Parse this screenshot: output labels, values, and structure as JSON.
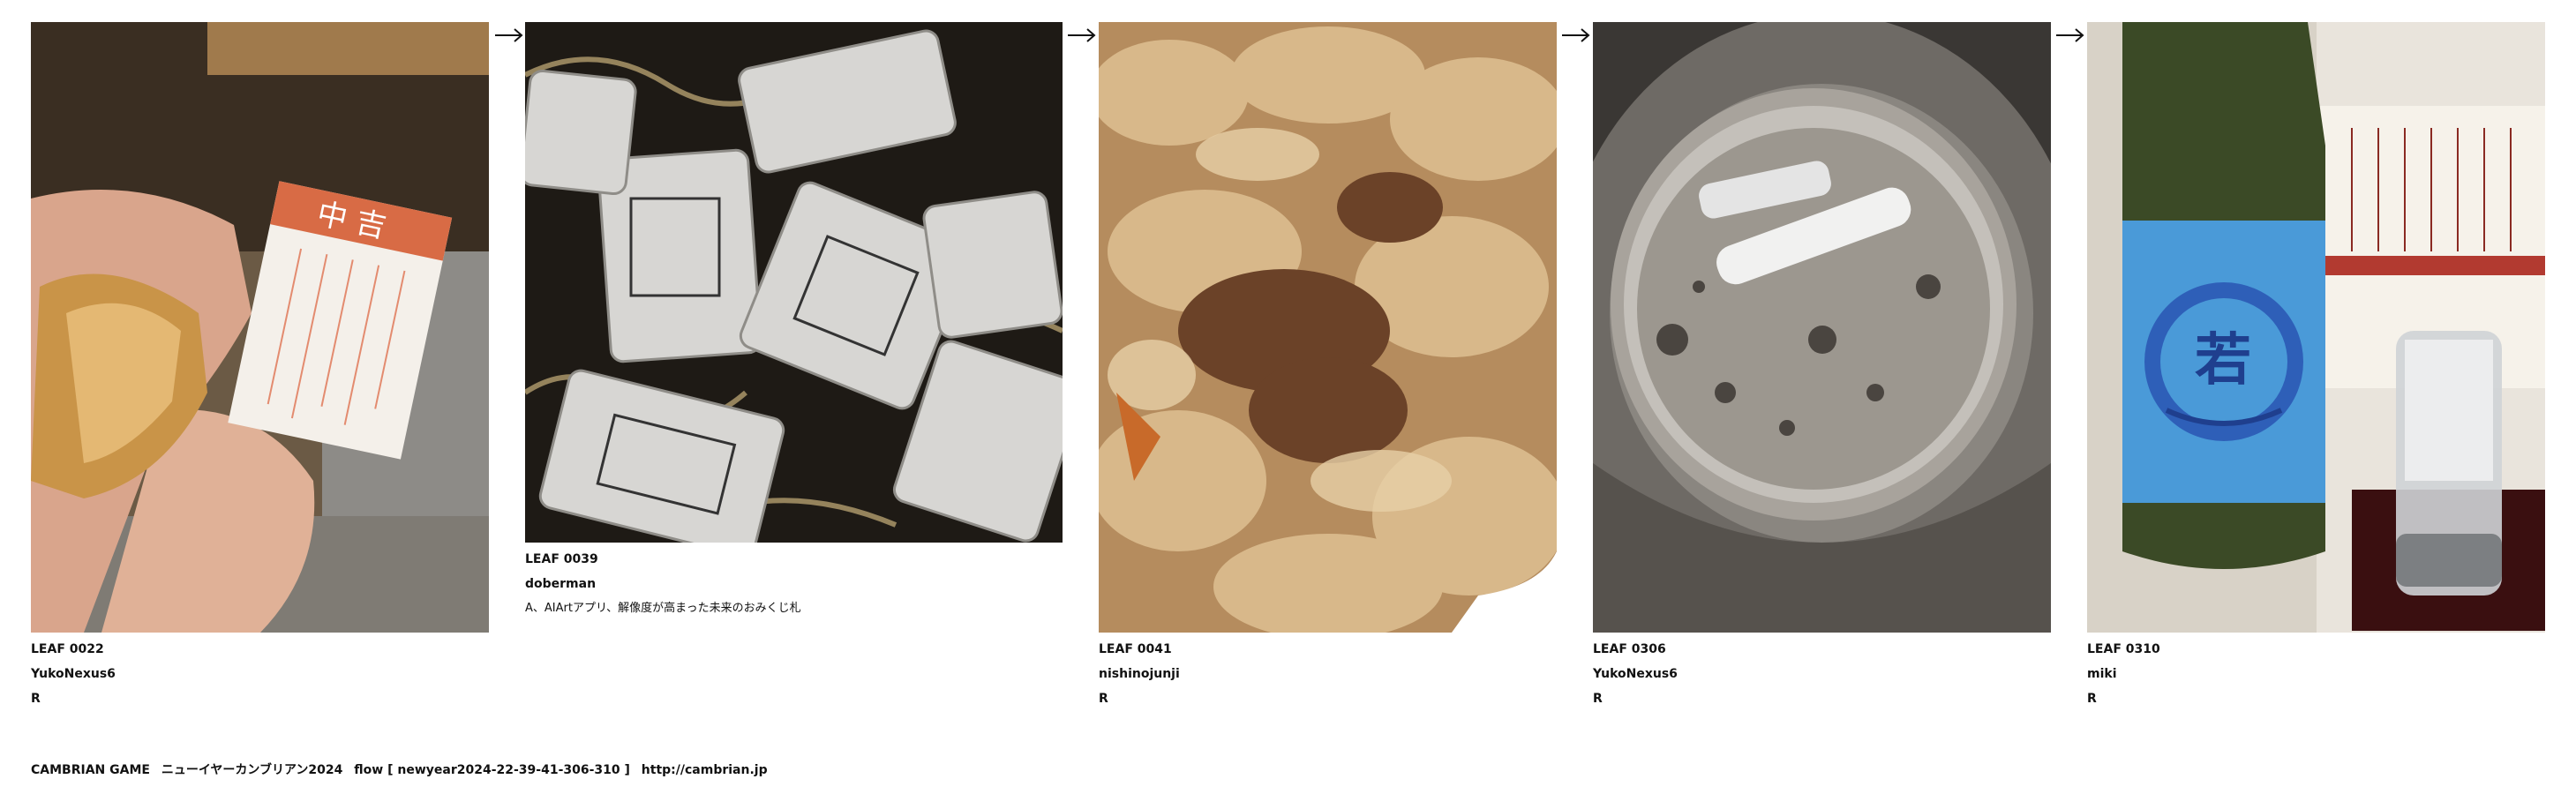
{
  "leaves": [
    {
      "id": "LEAF 0022",
      "author": "YukoNexus6",
      "rating": "R",
      "subject": "omikuji-fortune-cookie-photo"
    },
    {
      "id": "LEAF 0039",
      "author": "doberman",
      "note": "A、AIArtアプリ、解像度が高まった未来のおみくじ札",
      "subject": "ai-omikuji-cards-image"
    },
    {
      "id": "LEAF 0041",
      "author": "nishinojunji",
      "rating": "R",
      "subject": "gyudon-beef-bowl-photo"
    },
    {
      "id": "LEAF 0306",
      "author": "YukoNexus6",
      "rating": "R",
      "subject": "empty-can-interior-photo"
    },
    {
      "id": "LEAF 0310",
      "author": "miki",
      "rating": "R",
      "subject": "sake-bottle-and-glass-photo"
    }
  ],
  "arrow_icon": "right-arrow-icon",
  "footer": {
    "brand": "CAMBRIAN GAME",
    "event": "ニューイヤーカンブリアン2024",
    "flow_label": "flow [ newyear2024-22-39-41-306-310 ]",
    "url": "http://cambrian.jp"
  },
  "colors": {
    "background": "#ffffff",
    "text": "#111111",
    "sake_label_blue": "#4a9ad8"
  }
}
